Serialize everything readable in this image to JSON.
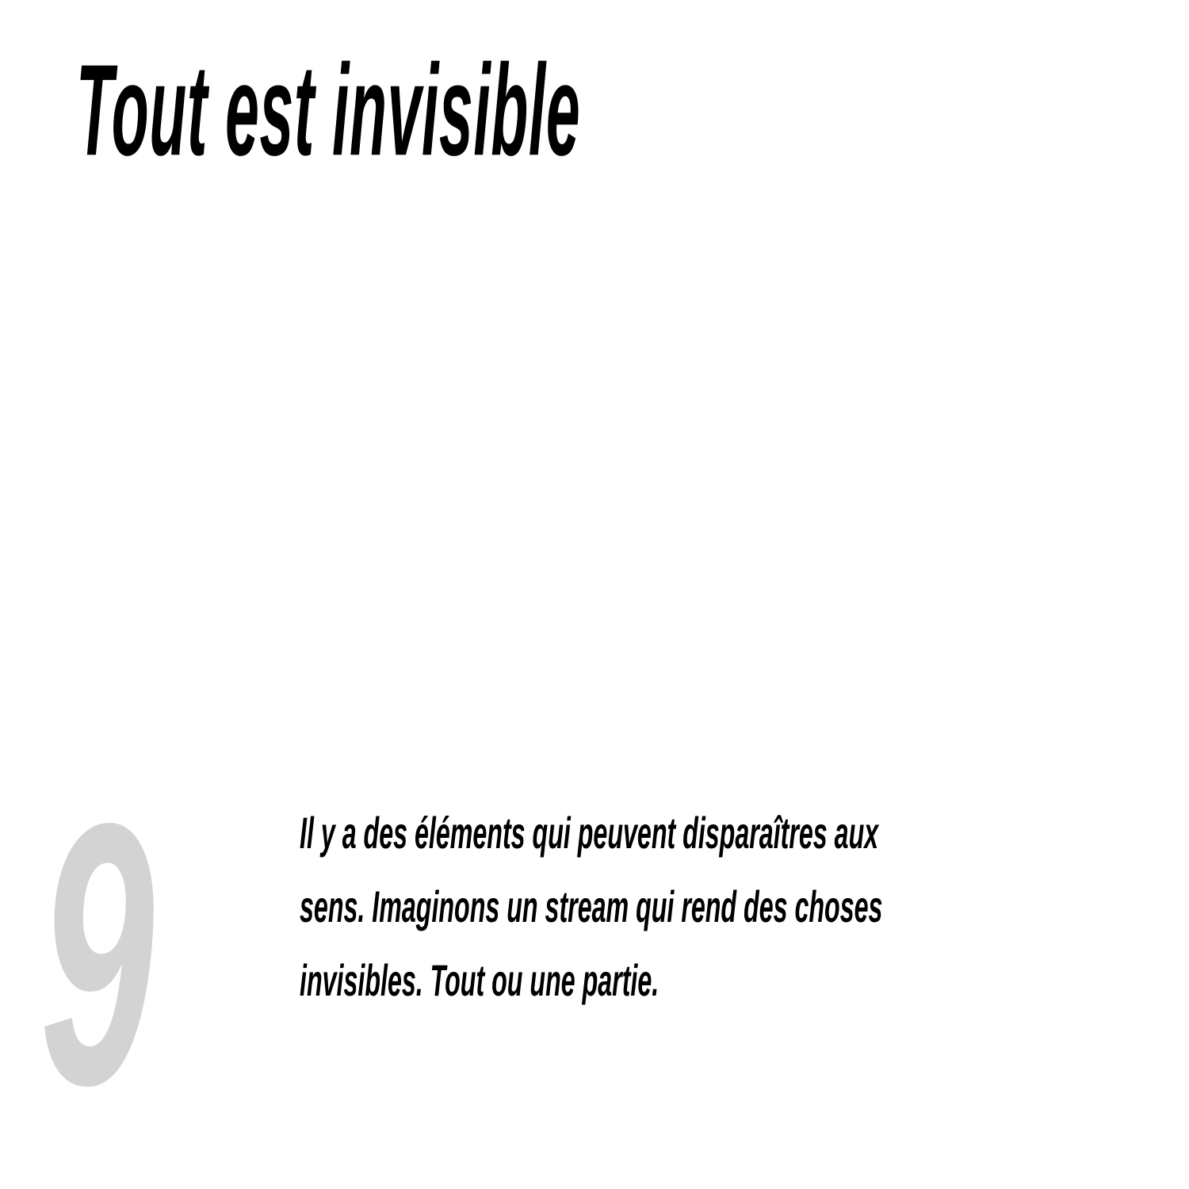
{
  "title": "Tout est invisible",
  "number": "9",
  "body_lines": [
    "Il y a des éléments qui peuvent disparaîtres aux",
    "sens. Imaginons un stream qui rend des choses",
    "invisibles. Tout ou une partie."
  ],
  "colors": {
    "text": "#000000",
    "number": "#d3d3d3",
    "background": "#ffffff"
  }
}
